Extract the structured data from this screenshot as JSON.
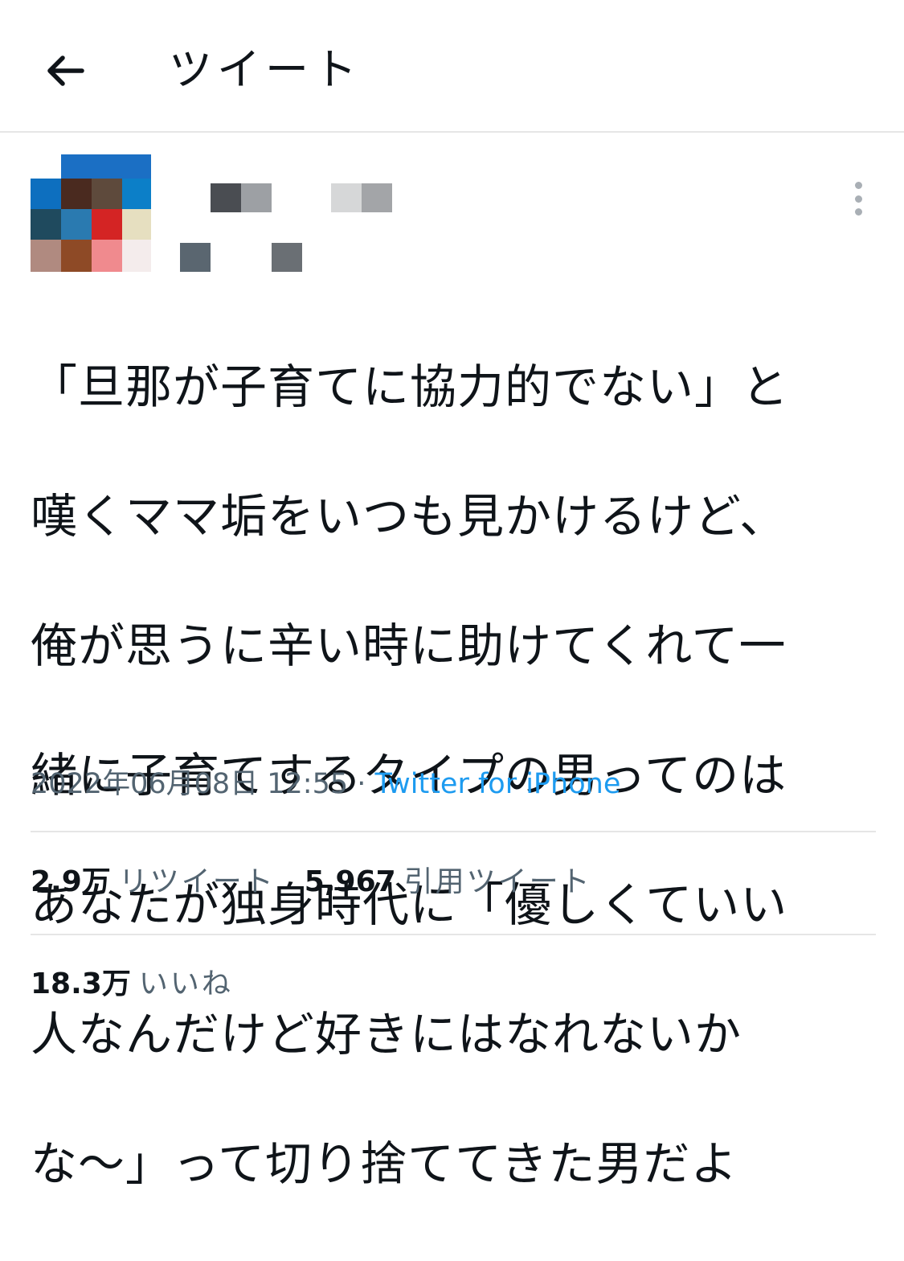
{
  "header": {
    "title": "ツイート",
    "back_icon": "arrow-left-icon"
  },
  "author": {
    "avatar_icon": "pixelated-avatar"
  },
  "tweet": {
    "lines": [
      "「旦那が子育てに協力的でない」と",
      "嘆くママ垢をいつも見かけるけど、",
      "俺が思うに辛い時に助けてくれて一",
      "緒に子育てするタイプの男ってのは",
      "あなたが独身時代に「優しくていい",
      "人なんだけど好きにはなれないか",
      "な〜」って切り捨ててきた男だよ"
    ],
    "timestamp": "2022年06月08日 12:55",
    "separator": " · ",
    "source": "Twitter for iPhone"
  },
  "stats": {
    "retweets_count": "2.9万",
    "retweets_label": "リツイート",
    "quotes_count": "5,967",
    "quotes_label": "引用ツイート",
    "likes_count": "18.3万",
    "likes_label": "いいね"
  },
  "colors": {
    "text": "#0f1419",
    "secondary": "#536471",
    "link": "#1d9bf0",
    "divider": "#e6e6e6"
  }
}
